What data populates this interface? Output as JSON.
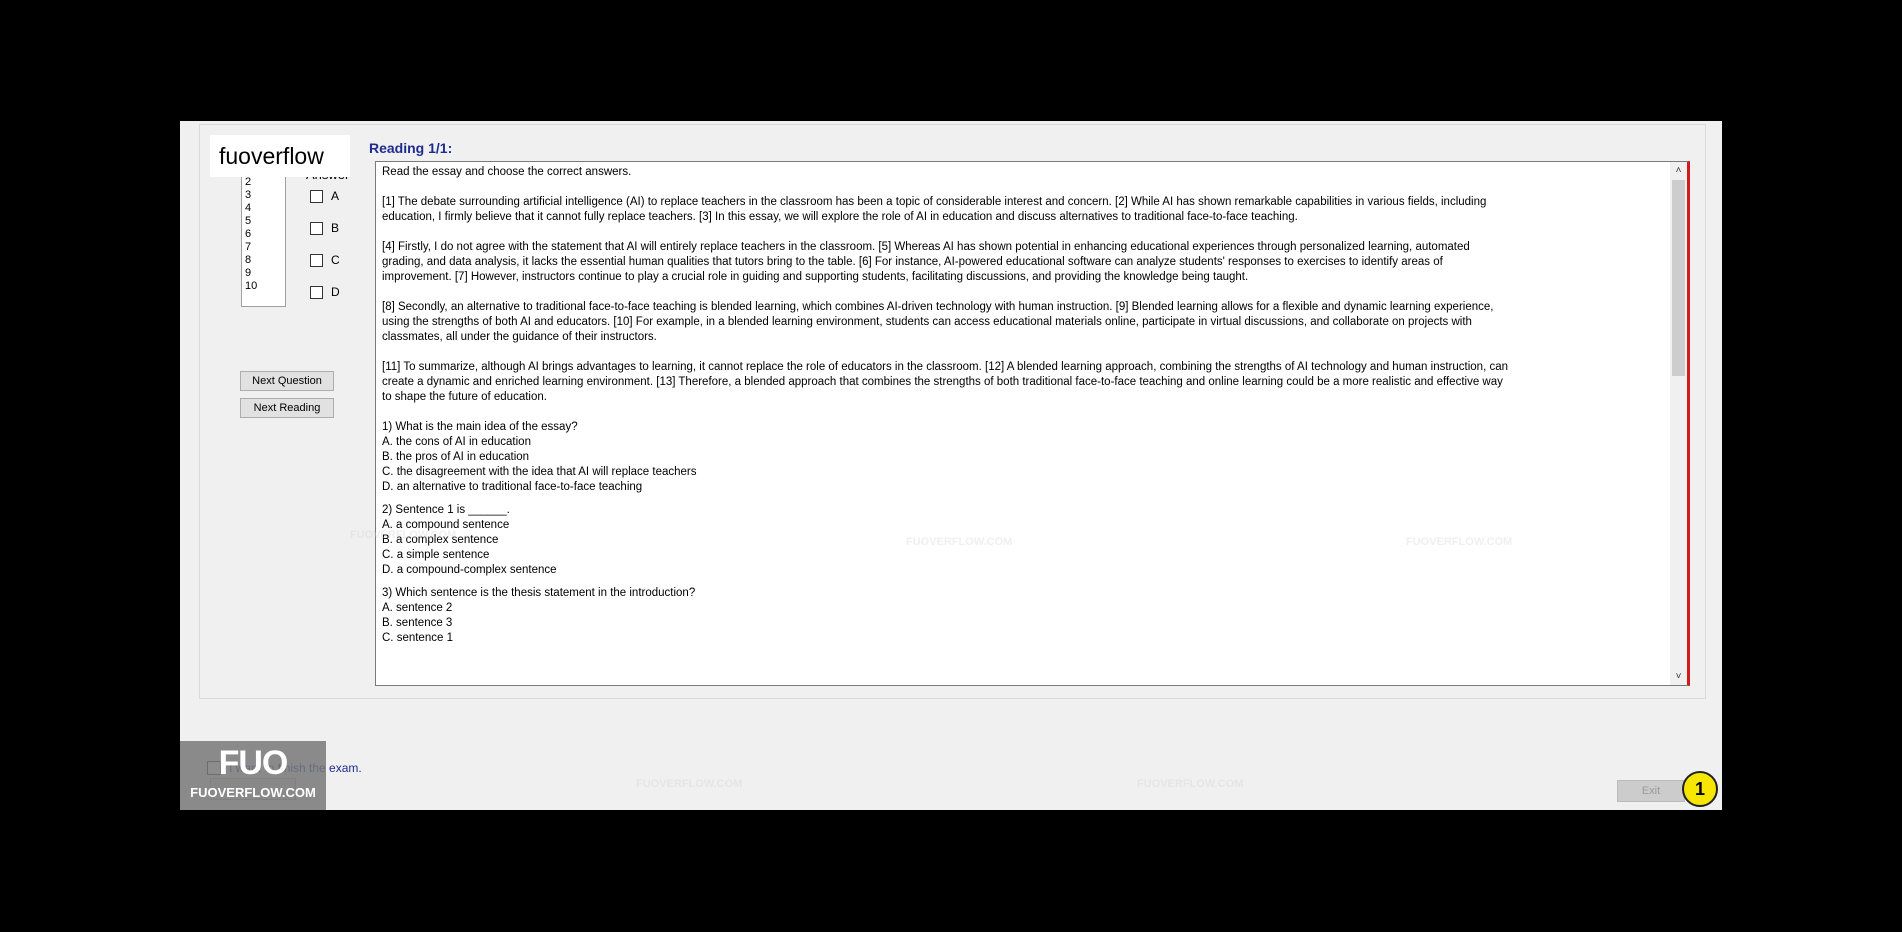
{
  "watermark_top_left": "fuoverflow",
  "answer_panel": {
    "label": "Answer",
    "question_numbers": [
      "2",
      "3",
      "4",
      "5",
      "6",
      "7",
      "8",
      "9",
      "10"
    ],
    "options": [
      "A",
      "B",
      "C",
      "D"
    ]
  },
  "buttons": {
    "next_question": "Next Question",
    "next_reading": "Next Reading",
    "exit": "Exit"
  },
  "reading": {
    "title": "Reading 1/1:",
    "instruction": "Read the essay and choose the correct answers.",
    "paragraphs": [
      "[1] The debate surrounding artificial intelligence (AI) to replace teachers in the classroom has been a topic of considerable interest and concern. [2] While AI has shown remarkable capabilities in various fields, including education, I firmly believe that it cannot fully replace teachers. [3] In this essay, we will explore the role of AI in education and discuss alternatives to traditional face-to-face teaching.",
      "[4] Firstly, I do not agree with the statement that AI will entirely replace teachers in the classroom. [5] Whereas AI has shown potential in enhancing educational experiences through personalized learning, automated grading, and data analysis, it lacks the essential human qualities that tutors bring to the table. [6] For instance, AI-powered educational software can analyze students' responses to exercises to identify areas of improvement. [7] However, instructors continue to play a crucial role in guiding and supporting students, facilitating discussions, and providing the knowledge being taught.",
      "[8] Secondly, an alternative to traditional face-to-face teaching is blended learning, which combines AI-driven technology with human instruction. [9] Blended learning allows for a flexible and dynamic learning experience, using the strengths of both AI and educators. [10] For example, in a blended learning environment, students can access educational materials online, participate in virtual discussions, and collaborate on projects with classmates, all under the guidance of their instructors.",
      "[11] To summarize, although AI brings advantages to learning, it cannot replace the role of educators in the classroom. [12] A blended learning approach, combining the strengths of AI technology and human instruction, can create a dynamic and enriched learning environment.  [13] Therefore, a blended approach that combines the strengths of both traditional face-to-face teaching and online learning could be a more realistic and effective way to shape the future of education."
    ],
    "questions": [
      {
        "stem": "1) What is the main idea of the essay?",
        "options": [
          "A.  the cons of AI in education",
          "B.  the pros of AI in education",
          "C.  the disagreement with the idea that AI will replace teachers",
          "D.  an alternative to traditional face-to-face teaching"
        ]
      },
      {
        "stem": "2) Sentence 1 is ______.",
        "options": [
          "A.  a compound sentence",
          "B.  a complex sentence",
          "C.  a simple sentence",
          "D.  a compound-complex sentence"
        ]
      },
      {
        "stem": "3) Which sentence is the thesis statement in the introduction?",
        "options": [
          "A.  sentence 2",
          "B.  sentence 3",
          "C.  sentence 1"
        ]
      }
    ]
  },
  "watermarks_faded": [
    "FUOVERFLOW.COM",
    "FUOVERFLOW.COM",
    "FUOVERFLOW.COM",
    "FUOVERFLOW.COM",
    "FUOVERFLOW.COM"
  ],
  "finish": {
    "label": "I want to finish the exam."
  },
  "logo": {
    "big": "FUO",
    "small": "FUOVERFLOW.COM"
  },
  "badge": "1"
}
